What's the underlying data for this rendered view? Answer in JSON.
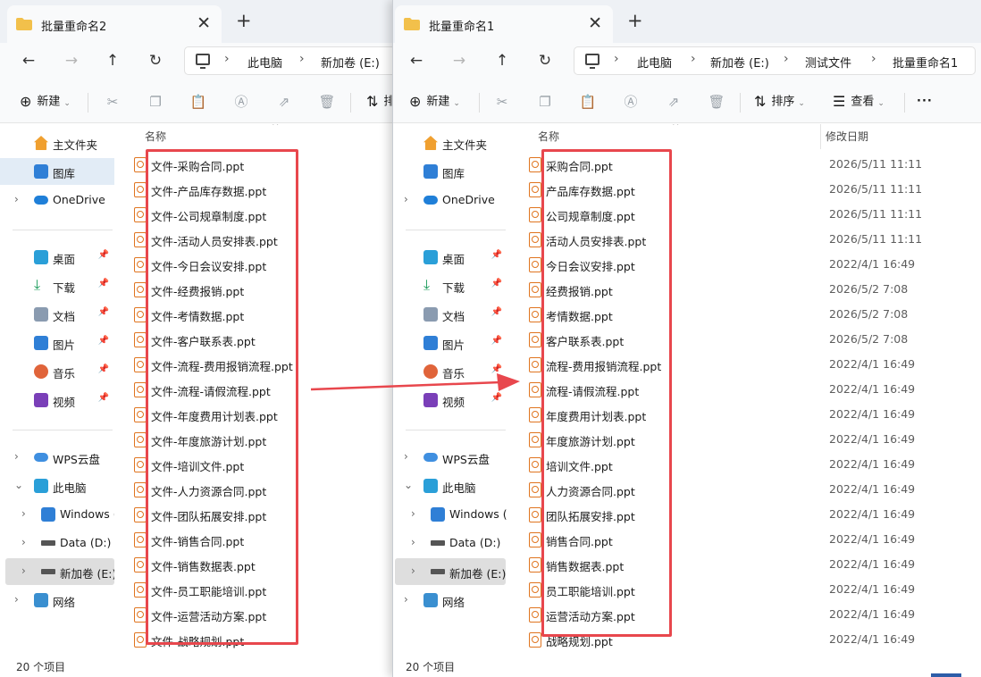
{
  "colors": {
    "highlight": "#e8474d",
    "ppt_icon": "#e07520",
    "folder": "#f2c04b",
    "selection": "#dedede"
  },
  "left": {
    "tab_title": "批量重命名2",
    "breadcrumbs": [
      "此电脑",
      "新加卷 (E:)"
    ],
    "toolbar": {
      "new_label": "新建",
      "sort_label": "排"
    },
    "column_name": "名称",
    "sidebar": [
      {
        "label": "主文件夹",
        "icon": "home-icon"
      },
      {
        "label": "图库",
        "icon": "gallery-icon"
      },
      {
        "label": "OneDrive",
        "icon": "onedrive-icon"
      },
      {
        "label": "桌面",
        "icon": "desktop-icon"
      },
      {
        "label": "下载",
        "icon": "download-icon"
      },
      {
        "label": "文档",
        "icon": "document-icon"
      },
      {
        "label": "图片",
        "icon": "pictures-icon"
      },
      {
        "label": "音乐",
        "icon": "music-icon"
      },
      {
        "label": "视频",
        "icon": "video-icon"
      },
      {
        "label": "WPS云盘",
        "icon": "wps-cloud-icon"
      },
      {
        "label": "此电脑",
        "icon": "this-pc-icon"
      },
      {
        "label": "Windows (",
        "icon": "windows-drive-icon"
      },
      {
        "label": "Data (D:)",
        "icon": "drive-icon"
      },
      {
        "label": "新加卷 (E:)",
        "icon": "drive-icon"
      },
      {
        "label": "网络",
        "icon": "network-icon"
      }
    ],
    "files": [
      "文件-采购合同.ppt",
      "文件-产品库存数据.ppt",
      "文件-公司规章制度.ppt",
      "文件-活动人员安排表.ppt",
      "文件-今日会议安排.ppt",
      "文件-经费报销.ppt",
      "文件-考情数据.ppt",
      "文件-客户联系表.ppt",
      "文件-流程-费用报销流程.ppt",
      "文件-流程-请假流程.ppt",
      "文件-年度费用计划表.ppt",
      "文件-年度旅游计划.ppt",
      "文件-培训文件.ppt",
      "文件-人力资源合同.ppt",
      "文件-团队拓展安排.ppt",
      "文件-销售合同.ppt",
      "文件-销售数据表.ppt",
      "文件-员工职能培训.ppt",
      "文件-运营活动方案.ppt",
      "文件-战略规划.ppt"
    ],
    "status": "20 个项目"
  },
  "right": {
    "tab_title": "批量重命名1",
    "breadcrumbs": [
      "此电脑",
      "新加卷 (E:)",
      "测试文件",
      "批量重命名1"
    ],
    "toolbar": {
      "new_label": "新建",
      "sort_label": "排序",
      "view_label": "查看",
      "more_label": "···"
    },
    "column_name": "名称",
    "column_date": "修改日期",
    "sidebar": [
      {
        "label": "主文件夹",
        "icon": "home-icon"
      },
      {
        "label": "图库",
        "icon": "gallery-icon"
      },
      {
        "label": "OneDrive",
        "icon": "onedrive-icon"
      },
      {
        "label": "桌面",
        "icon": "desktop-icon"
      },
      {
        "label": "下载",
        "icon": "download-icon"
      },
      {
        "label": "文档",
        "icon": "document-icon"
      },
      {
        "label": "图片",
        "icon": "pictures-icon"
      },
      {
        "label": "音乐",
        "icon": "music-icon"
      },
      {
        "label": "视频",
        "icon": "video-icon"
      },
      {
        "label": "WPS云盘",
        "icon": "wps-cloud-icon"
      },
      {
        "label": "此电脑",
        "icon": "this-pc-icon"
      },
      {
        "label": "Windows (C",
        "icon": "windows-drive-icon"
      },
      {
        "label": "Data (D:)",
        "icon": "drive-icon"
      },
      {
        "label": "新加卷 (E:)",
        "icon": "drive-icon"
      },
      {
        "label": "网络",
        "icon": "network-icon"
      }
    ],
    "files": [
      {
        "name": "采购合同.ppt",
        "date": "2026/5/11 11:11"
      },
      {
        "name": "产品库存数据.ppt",
        "date": "2026/5/11 11:11"
      },
      {
        "name": "公司规章制度.ppt",
        "date": "2026/5/11 11:11"
      },
      {
        "name": "活动人员安排表.ppt",
        "date": "2026/5/11 11:11"
      },
      {
        "name": "今日会议安排.ppt",
        "date": "2022/4/1 16:49"
      },
      {
        "name": "经费报销.ppt",
        "date": "2026/5/2 7:08"
      },
      {
        "name": "考情数据.ppt",
        "date": "2026/5/2 7:08"
      },
      {
        "name": "客户联系表.ppt",
        "date": "2026/5/2 7:08"
      },
      {
        "name": "流程-费用报销流程.ppt",
        "date": "2022/4/1 16:49"
      },
      {
        "name": "流程-请假流程.ppt",
        "date": "2022/4/1 16:49"
      },
      {
        "name": "年度费用计划表.ppt",
        "date": "2022/4/1 16:49"
      },
      {
        "name": "年度旅游计划.ppt",
        "date": "2022/4/1 16:49"
      },
      {
        "name": "培训文件.ppt",
        "date": "2022/4/1 16:49"
      },
      {
        "name": "人力资源合同.ppt",
        "date": "2022/4/1 16:49"
      },
      {
        "name": "团队拓展安排.ppt",
        "date": "2022/4/1 16:49"
      },
      {
        "name": "销售合同.ppt",
        "date": "2022/4/1 16:49"
      },
      {
        "name": "销售数据表.ppt",
        "date": "2022/4/1 16:49"
      },
      {
        "name": "员工职能培训.ppt",
        "date": "2022/4/1 16:49"
      },
      {
        "name": "运营活动方案.ppt",
        "date": "2022/4/1 16:49"
      },
      {
        "name": "战略规划.ppt",
        "date": "2022/4/1 16:49"
      }
    ],
    "status": "20 个项目"
  }
}
